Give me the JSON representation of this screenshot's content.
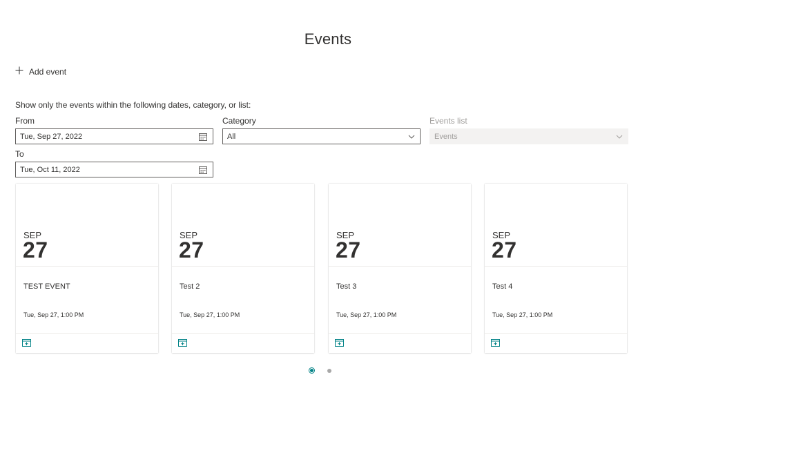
{
  "page_title": "Events",
  "add_event_label": "Add event",
  "filter": {
    "intro": "Show only the events within the following dates, category, or list:",
    "from_label": "From",
    "from_value": "Tue, Sep 27, 2022",
    "to_label": "To",
    "to_value": "Tue, Oct 11, 2022",
    "category_label": "Category",
    "category_value": "All",
    "events_list_label": "Events list",
    "events_list_value": "Events"
  },
  "cards": [
    {
      "month": "SEP",
      "day": "27",
      "title": "TEST EVENT",
      "time": "Tue, Sep 27, 1:00 PM"
    },
    {
      "month": "SEP",
      "day": "27",
      "title": "Test 2",
      "time": "Tue, Sep 27, 1:00 PM"
    },
    {
      "month": "SEP",
      "day": "27",
      "title": "Test 3",
      "time": "Tue, Sep 27, 1:00 PM"
    },
    {
      "month": "SEP",
      "day": "27",
      "title": "Test 4",
      "time": "Tue, Sep 27, 1:00 PM"
    }
  ],
  "pager": {
    "pages": 2,
    "current": 1
  },
  "icons": {
    "add": "plus-icon",
    "date_picker": "calendar-icon",
    "dropdown": "chevron-down-icon",
    "add_to_calendar": "calendar-add-icon"
  },
  "colors": {
    "accent": "#038387",
    "text": "#323130",
    "disabled_bg": "#f3f2f1"
  }
}
